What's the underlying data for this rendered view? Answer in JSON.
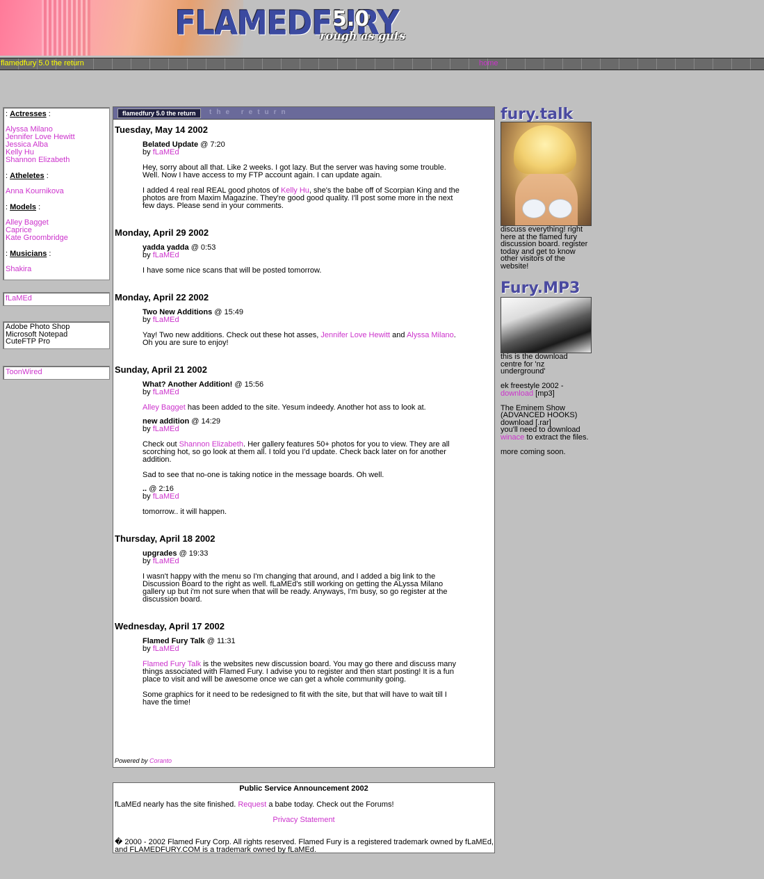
{
  "header": {
    "logo_main": "FLAMEDFURY",
    "logo_version": "5.0",
    "logo_slogan": "rough as guts"
  },
  "nav": {
    "title": "flamedfury 5.0 the return",
    "home": "home"
  },
  "categories": [
    {
      "label": "Actresses",
      "items": [
        "Alyssa Milano",
        "Jennifer Love Hewitt",
        "Jessica Alba",
        "Kelly Hu",
        "Shannon Elizabeth"
      ]
    },
    {
      "label": "Atheletes",
      "items": [
        "Anna Kournikova"
      ]
    },
    {
      "label": "Models",
      "items": [
        "Alley Bagget",
        "Caprice",
        "Kate Groombridge"
      ]
    },
    {
      "label": "Musicians",
      "items": [
        "Shakira"
      ]
    }
  ],
  "sidebar": {
    "user_link": "fLaMEd",
    "software": [
      "Adobe Photo Shop",
      "Microsoft Notepad",
      "CuteFTP Pro"
    ],
    "sponsor_link": "ToonWired"
  },
  "news": {
    "header_badge": "flamedfury 5.0 the return",
    "header_ghost": "the return",
    "days": [
      {
        "date": "Tuesday, May 14 2002",
        "entries": [
          {
            "title": "Belated Update",
            "time": "@ 7:20",
            "by": "by",
            "author": "fLaMEd",
            "paragraphs": [
              [
                {
                  "t": "Hey, sorry about all that. Like 2 weeks. I got lazy. But the server was having some trouble. Well. Now I have access to my FTP account again. I can update again."
                }
              ],
              [
                {
                  "t": "I added 4 real real REAL good photos of "
                },
                {
                  "t": "Kelly Hu",
                  "link": true
                },
                {
                  "t": ", she's the babe off of Scorpian King and the photos are from Maxim Magazine. They're good good quality. I'll post some more in the next few days. Please send in your comments."
                }
              ]
            ]
          }
        ]
      },
      {
        "date": "Monday, April 29 2002",
        "entries": [
          {
            "title": "yadda yadda",
            "time": "@ 0:53",
            "by": "by",
            "author": "fLaMEd",
            "paragraphs": [
              [
                {
                  "t": "I have some nice scans that will be posted tomorrow."
                }
              ]
            ]
          }
        ]
      },
      {
        "date": "Monday, April 22 2002",
        "entries": [
          {
            "title": "Two New Additions",
            "time": "@ 15:49",
            "by": "by",
            "author": "fLaMEd",
            "paragraphs": [
              [
                {
                  "t": "Yay! Two new additions. Check out these hot asses, "
                },
                {
                  "t": "Jennifer Love Hewitt",
                  "link": true
                },
                {
                  "t": " and "
                },
                {
                  "t": "Alyssa Milano",
                  "link": true
                },
                {
                  "t": ". Oh you are sure to enjoy!"
                }
              ]
            ]
          }
        ]
      },
      {
        "date": "Sunday, April 21 2002",
        "entries": [
          {
            "title": "What? Another Addition!",
            "time": "@ 15:56",
            "by": "by",
            "author": "fLaMEd",
            "paragraphs": [
              [
                {
                  "t": "Alley Bagget",
                  "link": true
                },
                {
                  "t": " has been added to the site. Yesum indeedy. Another hot ass to look at."
                }
              ]
            ]
          },
          {
            "title": "new addition",
            "time": "@ 14:29",
            "by": "by",
            "author": "fLaMEd",
            "paragraphs": [
              [
                {
                  "t": "Check out "
                },
                {
                  "t": "Shannon Elizabeth",
                  "link": true
                },
                {
                  "t": ". Her gallery features 50+ photos for you to view. They are all scorching hot, so go look at them all. I told you I'd update. Check back later on for another addition."
                }
              ],
              [
                {
                  "t": "Sad to see that no-one is taking notice in the message boards. Oh well."
                }
              ]
            ]
          },
          {
            "title": "..",
            "time": "@ 2:16",
            "by": "by",
            "author": "fLaMEd",
            "paragraphs": [
              [
                {
                  "t": "tomorrow.. it will happen."
                }
              ]
            ]
          }
        ]
      },
      {
        "date": "Thursday, April 18 2002",
        "entries": [
          {
            "title": "upgrades",
            "time": "@ 19:33",
            "by": "by",
            "author": "fLaMEd",
            "paragraphs": [
              [
                {
                  "t": "I wasn't happy with the menu so I'm changing that around, and I added a big link to the Discussion Board to the right as well. fLaMEd's still working on getting the ALyssa Milano gallery up but i'm not sure when that will be ready. Anyways, I'm busy, so go register at the discussion board."
                }
              ]
            ]
          }
        ]
      },
      {
        "date": "Wednesday, April 17 2002",
        "entries": [
          {
            "title": "Flamed Fury Talk",
            "time": "@ 11:31",
            "by": "by",
            "author": "fLaMEd",
            "paragraphs": [
              [
                {
                  "t": "Flamed Fury Talk",
                  "link": true
                },
                {
                  "t": " is the websites new discussion board. You may go there and discuss many things associated with Flamed Fury. I advise you to register and then start posting! It is a fun place to visit and will be awesome once we can get a whole community going."
                }
              ],
              [
                {
                  "t": "Some graphics for it need to be redesigned to fit with the site, but that will have to wait till I have the time!"
                }
              ]
            ]
          }
        ]
      }
    ],
    "powered_label": "Powered by",
    "powered_link": "Coranto"
  },
  "psa": {
    "title": "Public Service Announcement 2002",
    "text_before": "fLaMEd nearly has the site finished.",
    "link": "Request",
    "text_after": "a babe today. Check out the Forums!",
    "privacy": "Privacy Statement",
    "copyright": "� 2000 - 2002 Flamed Fury Corp. All rights reserved. Flamed Fury is a registered trademark owned by fLaMEd, and FLAMEDFURY.COM is a trademark owned by fLaMEd."
  },
  "right": {
    "talk_title": "fury.talk",
    "talk_text": "discuss everything! right here at the flamed fury discussion board. register today and get to know other visitors of the website!",
    "mp3_title": "Fury.MP3",
    "mp3_intro": "this is the download centre for 'nz underground'",
    "item1_text": "ek freestyle 2002 -",
    "item1_link": "download",
    "item1_fmt": "[mp3]",
    "item2_line1": "The Eminem Show",
    "item2_line2": "(ADVANCED HOOKS)",
    "item2_line3": "download [.rar]",
    "item2_line4": "you'll need to download",
    "winace_link": "winace",
    "winace_after": "to extract the files.",
    "more": "more coming soon."
  },
  "colors": {
    "background": "#c0c0c0",
    "link": "#cc33cc",
    "nav_title": "#ffff00",
    "nav_bar": "#6a6a6a"
  }
}
